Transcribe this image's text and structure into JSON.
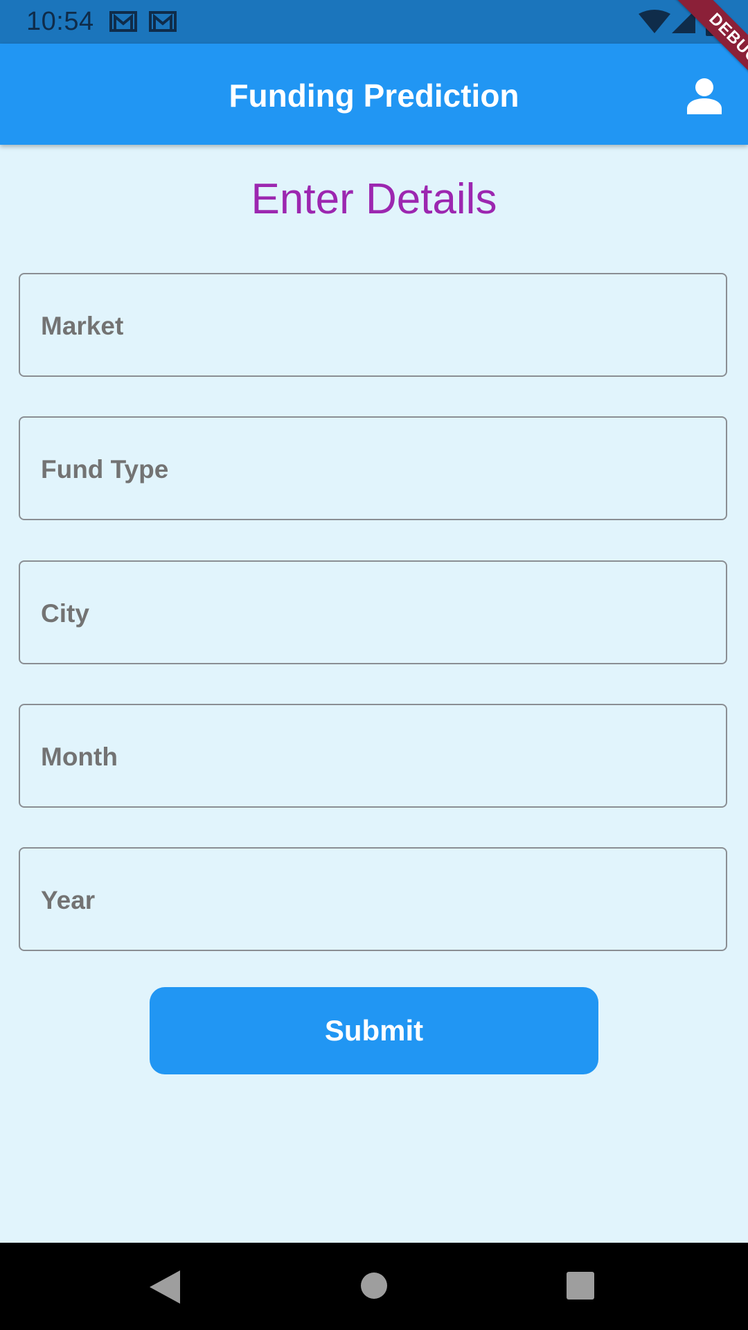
{
  "status_bar": {
    "time": "10:54",
    "icons": [
      "mail-icon",
      "mail-icon",
      "wifi-icon",
      "signal-icon",
      "battery-icon"
    ]
  },
  "app_bar": {
    "title": "Funding Prediction",
    "profile_icon": "person-icon"
  },
  "debug_banner": "DEBUG",
  "form": {
    "heading": "Enter Details",
    "fields": [
      {
        "label": "Market",
        "value": ""
      },
      {
        "label": "Fund Type",
        "value": ""
      },
      {
        "label": "City",
        "value": ""
      },
      {
        "label": "Month",
        "value": ""
      },
      {
        "label": "Year",
        "value": ""
      }
    ],
    "submit_label": "Submit"
  },
  "nav_bar": {
    "icons": [
      "back-icon",
      "home-icon",
      "recents-icon"
    ]
  },
  "colors": {
    "status_bar": "#1B75BC",
    "app_bar": "#2196F3",
    "background": "#E1F4FC",
    "heading": "#9C27B0",
    "field_border": "#8A8E93",
    "field_label": "#737373",
    "button": "#2196F3",
    "debug_banner": "#8B2038"
  }
}
